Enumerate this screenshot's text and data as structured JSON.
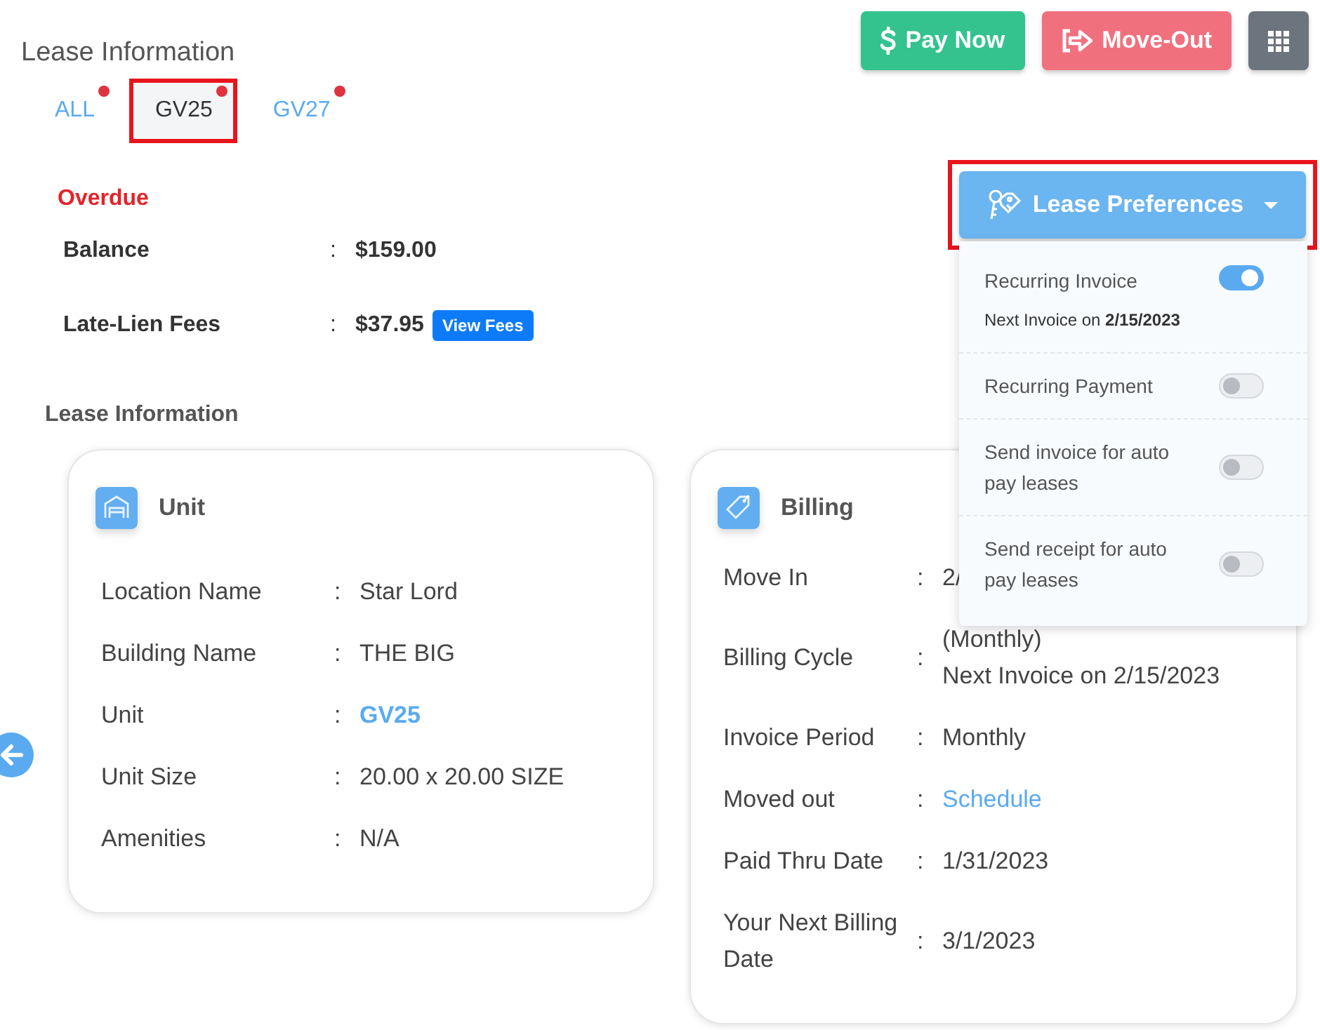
{
  "page_title": "Lease Information",
  "tabs": [
    {
      "label": "ALL",
      "selected": false,
      "alert": true,
      "highlighted": false
    },
    {
      "label": "GV25",
      "selected": true,
      "alert": true,
      "highlighted": true
    },
    {
      "label": "GV27",
      "selected": false,
      "alert": true,
      "highlighted": false
    }
  ],
  "actions": [
    {
      "kind": "pay",
      "label": "Pay Now"
    },
    {
      "kind": "move_out",
      "label": "Move-Out"
    },
    {
      "kind": "apps"
    }
  ],
  "status": "Overdue",
  "summary": [
    {
      "label": "Balance",
      "sep": ":",
      "value": "$159.00"
    },
    {
      "label": "Late-Lien Fees",
      "sep": ":",
      "value": "$37.95",
      "button": "View Fees"
    }
  ],
  "preferences": {
    "button": "Lease Preferences",
    "highlighted": true,
    "items": [
      {
        "label": "Recurring Invoice",
        "on": true,
        "note": "Next Invoice on **2/15/2023**"
      },
      {
        "label": "Recurring Payment",
        "on": false
      },
      {
        "label": "Send invoice for auto pay leases",
        "on": false
      },
      {
        "label": "Send receipt for auto pay leases",
        "on": false
      }
    ]
  },
  "section_title": "Lease Information",
  "cards": [
    {
      "kind": "unit",
      "title": "Unit",
      "rows": [
        {
          "label": "Location Name",
          "sep": ":",
          "value": "Star Lord"
        },
        {
          "label": "Building Name",
          "sep": ":",
          "value": "THE BIG"
        },
        {
          "label": "Unit",
          "sep": ":",
          "value": "GV25",
          "link": true,
          "bold": true
        },
        {
          "label": "Unit Size",
          "sep": ":",
          "value": "20.00 x 20.00 SIZE"
        },
        {
          "label": "Amenities",
          "sep": ":",
          "value": "N/A"
        }
      ]
    },
    {
      "kind": "billing",
      "title": "Billing",
      "rows": [
        {
          "label": "Move In",
          "sep": ":",
          "value": "2/"
        },
        {
          "label": "Billing Cycle",
          "sep": ":",
          "value_lines": [
            "(Monthly)",
            "Next Invoice on 2/15/2023"
          ]
        },
        {
          "label": "Invoice Period",
          "sep": ":",
          "value": "Monthly"
        },
        {
          "label": "Moved out",
          "sep": ":",
          "value": "Schedule",
          "link": true,
          "bold": false
        },
        {
          "label": "Paid Thru Date",
          "sep": ":",
          "value": "1/31/2023"
        },
        {
          "label": "Your Next Billing Date",
          "sep": ":",
          "value": "3/1/2023"
        }
      ]
    }
  ]
}
